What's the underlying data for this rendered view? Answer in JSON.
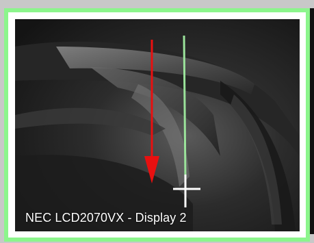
{
  "display": {
    "label": "NEC LCD2070VX - Display 2"
  },
  "colors": {
    "frame_border": "#8cf58c",
    "drag_arrow": "#e81010",
    "guide_line": "#9be39b",
    "crosshair": "#ffffff"
  },
  "icons": {
    "drag_arrow": "arrow-down-icon",
    "cursor": "crosshair-cursor-icon"
  }
}
